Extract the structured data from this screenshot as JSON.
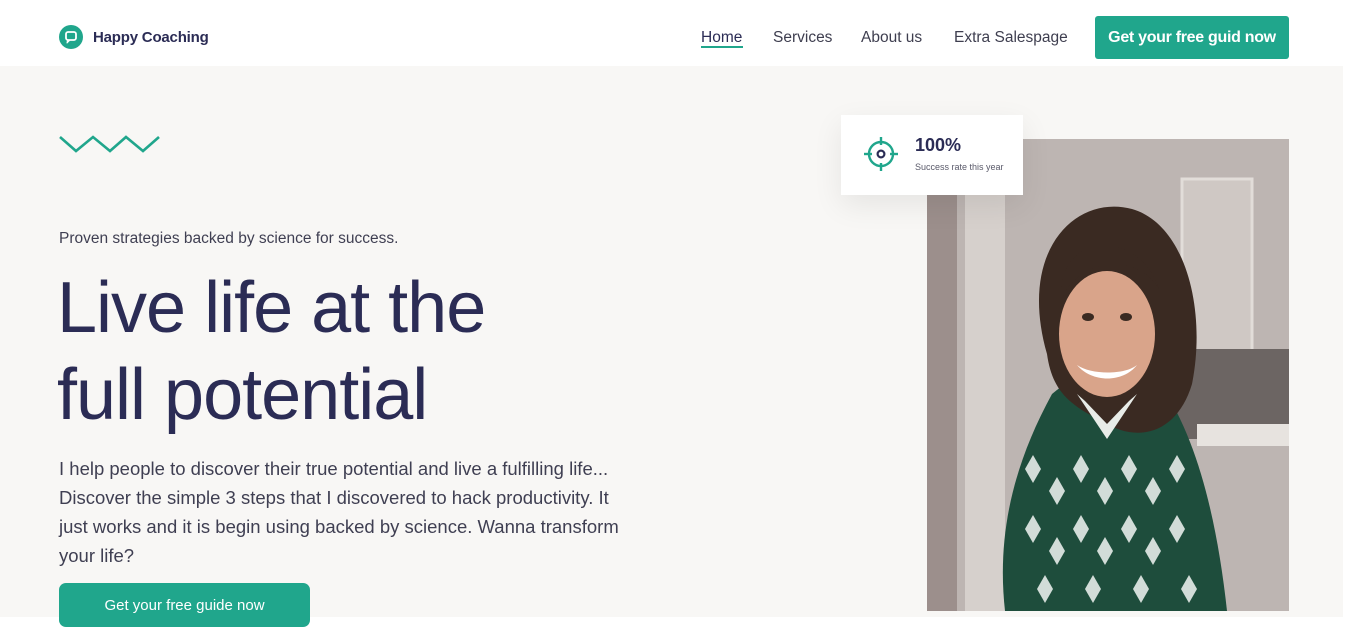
{
  "brand": {
    "name": "Happy Coaching",
    "logo_icon": "chat-bubble-icon"
  },
  "nav": {
    "items": [
      {
        "label": "Home",
        "active": true
      },
      {
        "label": "Services",
        "active": false
      },
      {
        "label": "About us",
        "active": false
      },
      {
        "label": "Extra Salespage",
        "active": false
      }
    ],
    "cta_label": "Get your free guid now"
  },
  "hero": {
    "decoration_icon": "zigzag-icon",
    "eyebrow": "Proven strategies backed by science for success.",
    "headline_line1": "Live life at the",
    "headline_line2": "full potential",
    "intro": "I help people to discover their true potential and live a fulfilling life... Discover the simple 3 steps that I discovered to hack productivity. It just works and it is begin using backed by science. Wanna transform your life?",
    "cta_label": "Get your free guide now"
  },
  "stat_card": {
    "icon": "target-icon",
    "value": "100%",
    "label": "Success rate this year"
  },
  "photo": {
    "icon": "portrait-photo"
  },
  "colors": {
    "accent": "#20a68c",
    "heading": "#2b2c55",
    "hero_background": "#f8f7f5"
  }
}
